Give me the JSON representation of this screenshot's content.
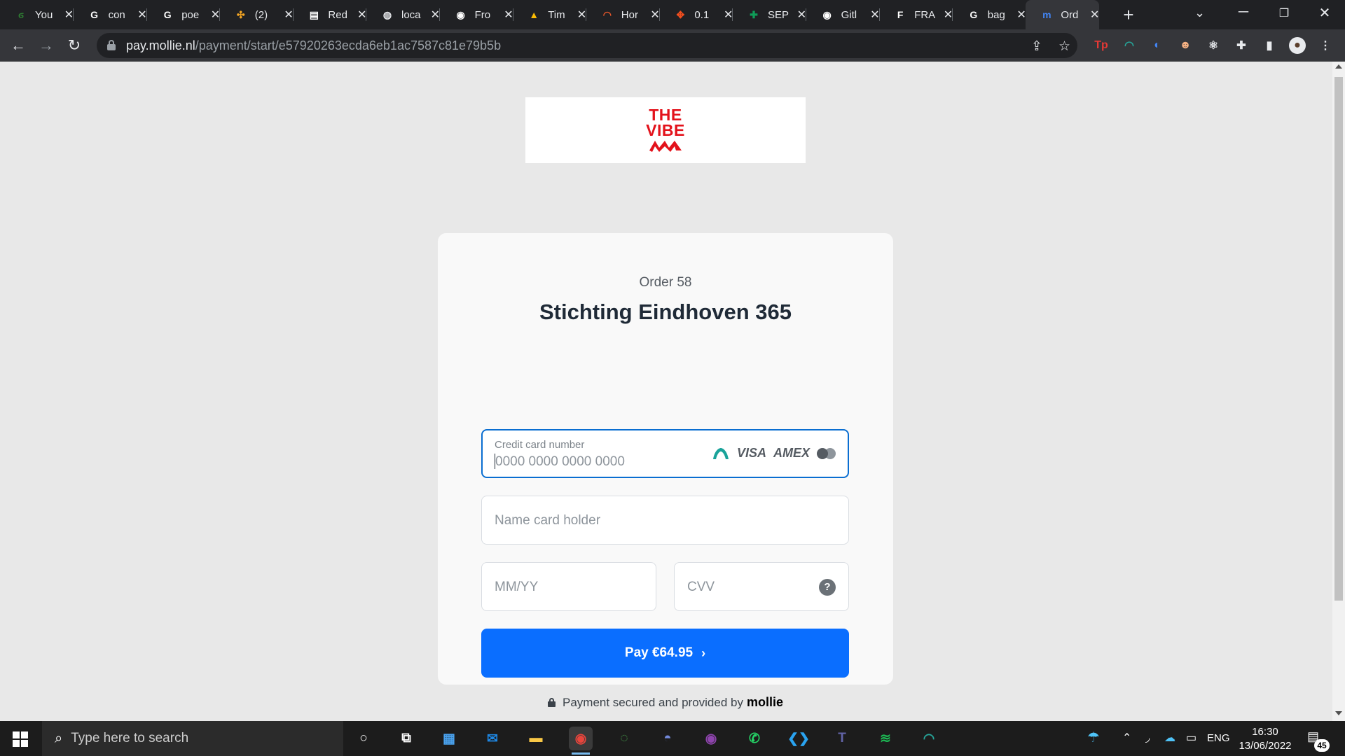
{
  "browser": {
    "tabs": [
      {
        "title": "You",
        "favicon": "leaf-icon",
        "color": "#2e7d32",
        "glyph": "ϭ"
      },
      {
        "title": "con",
        "favicon": "google-icon",
        "color": "#ffffff",
        "glyph": "G"
      },
      {
        "title": "poe",
        "favicon": "google-icon",
        "color": "#ffffff",
        "glyph": "G"
      },
      {
        "title": "(2)",
        "favicon": "dots-icon",
        "color": "#f5a623",
        "glyph": "✣"
      },
      {
        "title": "Red",
        "favicon": "doc-icon",
        "color": "#ffffff",
        "glyph": "▤"
      },
      {
        "title": "loca",
        "favicon": "globe-icon",
        "color": "#e8eaed",
        "glyph": "◍"
      },
      {
        "title": "Fro",
        "favicon": "github-icon",
        "color": "#ffffff",
        "glyph": "◉"
      },
      {
        "title": "Tim",
        "favicon": "drive-icon",
        "color": "#fbbc04",
        "glyph": "▲"
      },
      {
        "title": "Hor",
        "favicon": "arc-icon",
        "color": "#e8572a",
        "glyph": "◠"
      },
      {
        "title": "0.1",
        "favicon": "figma-icon",
        "color": "#f24e1e",
        "glyph": "✥"
      },
      {
        "title": "SEP",
        "favicon": "sheets-icon",
        "color": "#0f9d58",
        "glyph": "✚"
      },
      {
        "title": "Gitl",
        "favicon": "github-icon",
        "color": "#ffffff",
        "glyph": "◉"
      },
      {
        "title": "FRA",
        "favicon": "f-icon",
        "color": "#ffffff",
        "glyph": "F"
      },
      {
        "title": "bag",
        "favicon": "google-icon",
        "color": "#ffffff",
        "glyph": "G"
      },
      {
        "title": "Ord",
        "favicon": "mollie-icon",
        "color": "#4285f4",
        "glyph": "m",
        "active": true
      }
    ],
    "url_host": "pay.mollie.nl",
    "url_path": "/payment/start/e57920263ecda6eb1ac7587c81e79b5b"
  },
  "logo": {
    "line1": "THE",
    "line2": "VIBE",
    "color": "#e3121b"
  },
  "checkout": {
    "order_label": "Order 58",
    "merchant": "Stichting Eindhoven 365",
    "card_number_label": "Credit card number",
    "card_number_placeholder": "0000 0000 0000 0000",
    "card_number_value": "",
    "brands": {
      "visa": "VISA",
      "amex": "AMEX"
    },
    "name_placeholder": "Name card holder",
    "name_value": "",
    "expiry_placeholder": "MM/YY",
    "expiry_value": "",
    "cvv_placeholder": "CVV",
    "cvv_value": "",
    "cvv_help": "?",
    "pay_label": "Pay €64.95",
    "pay_chevron": "›",
    "secured_text": "Payment secured and provided by",
    "provider": "mollie",
    "accent_color": "#0a6eff"
  },
  "taskbar": {
    "search_placeholder": "Type here to search",
    "apps": [
      "cortana-icon",
      "task-view-icon",
      "calendar-icon",
      "outlook-icon",
      "file-explorer-icon",
      "chrome-icon",
      "spinner-app-icon",
      "discord-icon",
      "github-desktop-icon",
      "whatsapp-icon",
      "vscode-icon",
      "teams-icon",
      "spotify-icon",
      "arc-app-icon"
    ],
    "language": "ENG",
    "time": "16:30",
    "date": "13/06/2022",
    "notification_count": "45"
  }
}
